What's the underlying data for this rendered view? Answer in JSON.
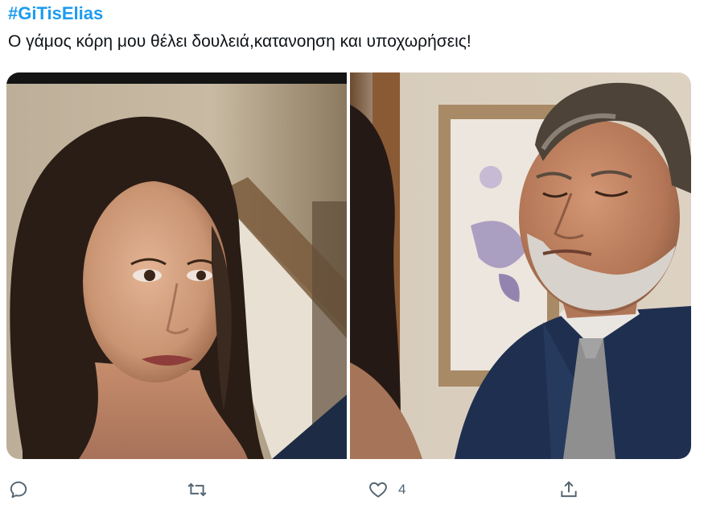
{
  "tweet": {
    "hashtag": "#GiTisElias",
    "text": "Ο γάμος κόρη μου θέλει δουλειά,κατανοηση και  υποχωρήσεις!"
  },
  "media": {
    "images": [
      {
        "name": "photo-left"
      },
      {
        "name": "photo-right"
      }
    ]
  },
  "actions": {
    "reply": {
      "icon": "reply-icon",
      "count": ""
    },
    "retweet": {
      "icon": "retweet-icon",
      "count": ""
    },
    "like": {
      "icon": "heart-icon",
      "count": "4"
    },
    "share": {
      "icon": "share-icon",
      "count": ""
    }
  },
  "colors": {
    "accent": "#1d9bf0",
    "text": "#0f1419",
    "muted": "#536471"
  }
}
